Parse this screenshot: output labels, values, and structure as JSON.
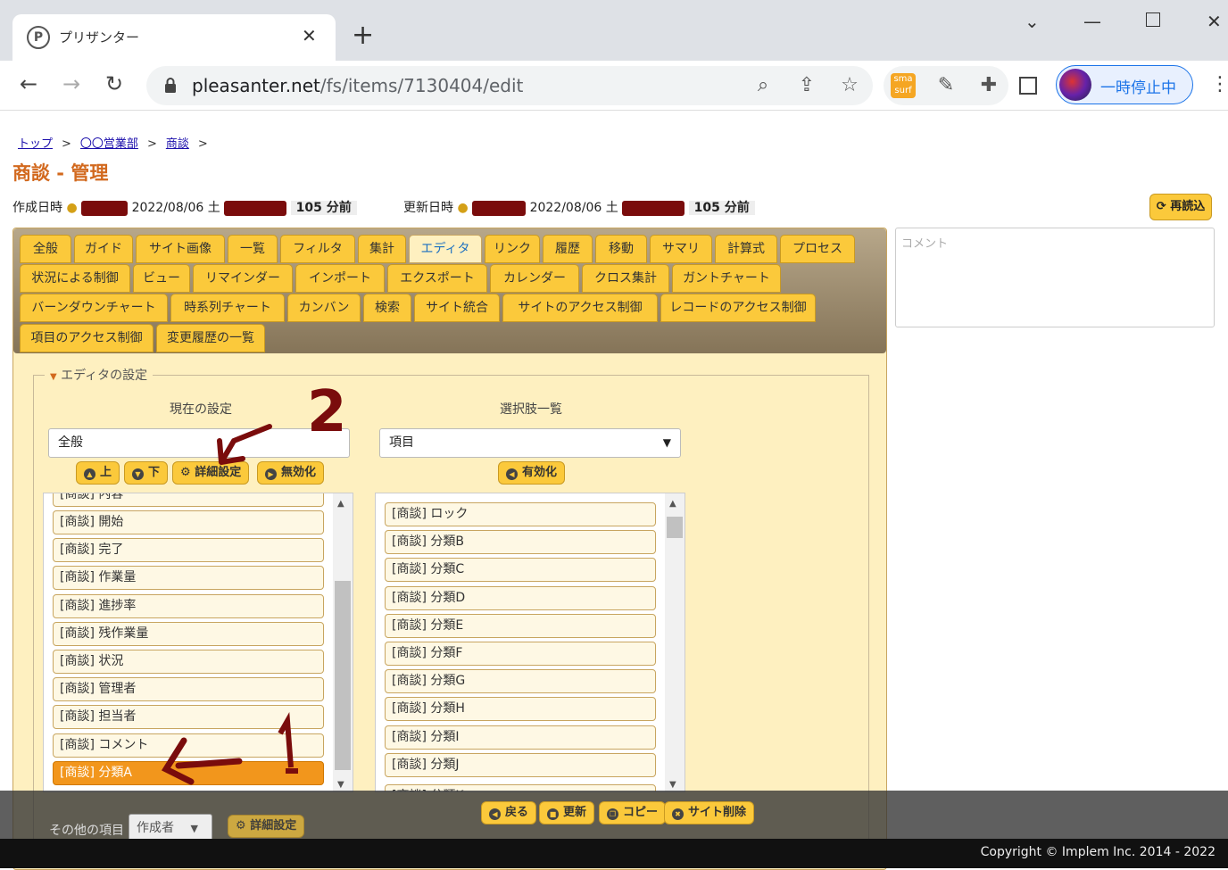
{
  "browser": {
    "tab_title": "プリザンター",
    "url_host": "pleasanter.net",
    "url_path": "/fs/items/7130404/edit",
    "profile_label": "一時停止中"
  },
  "breadcrumb": [
    "トップ",
    "〇〇営業部",
    "商談"
  ],
  "page_title": "商談 - 管理",
  "meta": {
    "created_label": "作成日時",
    "created_date": "2022/08/06 土",
    "created_ago": "105 分前",
    "updated_label": "更新日時",
    "updated_date": "2022/08/06 土",
    "updated_ago": "105 分前"
  },
  "reload_label": "再読込",
  "comment_placeholder": "コメント",
  "tabs_row1": [
    "全般",
    "ガイド",
    "サイト画像",
    "一覧",
    "フィルタ",
    "集計",
    "エディタ",
    "リンク",
    "履歴",
    "移動",
    "サマリ",
    "計算式",
    "プロセス"
  ],
  "tabs_row2": [
    "状況による制御",
    "ビュー",
    "リマインダー",
    "インポート",
    "エクスポート",
    "カレンダー",
    "クロス集計",
    "ガントチャート"
  ],
  "tabs_row3": [
    "バーンダウンチャート",
    "時系列チャート",
    "カンバン",
    "検索",
    "サイト統合",
    "サイトのアクセス制御",
    "レコードのアクセス制御"
  ],
  "tabs_row4": [
    "項目のアクセス制御",
    "変更履歴の一覧"
  ],
  "active_tab": "エディタ",
  "editor": {
    "legend": "エディタの設定",
    "current_header": "現在の設定",
    "options_header": "選択肢一覧",
    "current_select": "全般",
    "options_select": "項目",
    "btn_up": "上",
    "btn_down": "下",
    "btn_detail": "詳細設定",
    "btn_disable": "無効化",
    "btn_enable": "有効化",
    "current_list_partial_top": "[商談] 内容",
    "current_list": [
      "[商談] 開始",
      "[商談] 完了",
      "[商談] 作業量",
      "[商談] 進捗率",
      "[商談] 残作業量",
      "[商談] 状況",
      "[商談] 管理者",
      "[商談] 担当者",
      "[商談] コメント",
      "[商談] 分類A"
    ],
    "current_selected": "[商談] 分類A",
    "options_list": [
      "[商談] ロック",
      "[商談] 分類B",
      "[商談] 分類C",
      "[商談] 分類D",
      "[商談] 分類E",
      "[商談] 分類F",
      "[商談] 分類G",
      "[商談] 分類H",
      "[商談] 分類I",
      "[商談] 分類J"
    ],
    "options_list_partial_bottom": "[商談] 分類K",
    "other_items_label": "その他の項目",
    "other_items_select": "作成者",
    "other_detail_btn": "詳細設定"
  },
  "footer_buttons": [
    "戻る",
    "更新",
    "コピー",
    "サイト削除"
  ],
  "copyright": "Copyright © Implem Inc. 2014 - 2022",
  "annotations": {
    "step1": "1",
    "step2": "2"
  },
  "colors": {
    "accent_orange": "#d2691e",
    "button_yellow": "#fbc93b",
    "selected_item": "#f2961c",
    "annotation_red": "#7a0c0c"
  }
}
